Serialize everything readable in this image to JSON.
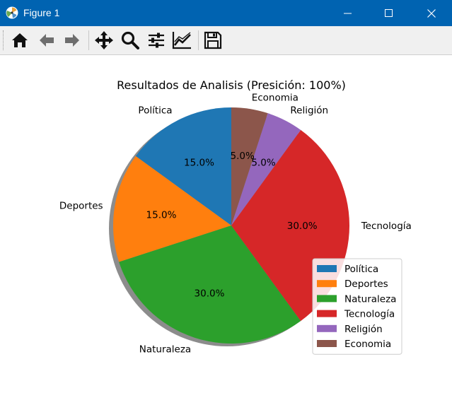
{
  "window": {
    "title": "Figure 1"
  },
  "toolbar": {
    "tools": [
      "home-icon",
      "back-icon",
      "forward-icon",
      "pan-icon",
      "zoom-icon",
      "configure-subplots-icon",
      "edit-axis-icon",
      "save-icon"
    ]
  },
  "chart_data": {
    "type": "pie",
    "title": "Resultados de Analisis (Presición: 100%)",
    "categories": [
      "Política",
      "Deportes",
      "Naturaleza",
      "Tecnología",
      "Religión",
      "Economia"
    ],
    "values": [
      15.0,
      15.0,
      30.0,
      30.0,
      5.0,
      5.0
    ],
    "value_labels": [
      "15.0%",
      "15.0%",
      "30.0%",
      "30.0%",
      "5.0%",
      "5.0%"
    ],
    "colors": [
      "#1f77b4",
      "#ff7f0e",
      "#2ca02c",
      "#d62728",
      "#9467bd",
      "#8c564b"
    ],
    "start_angle": 90,
    "direction": "counterclockwise",
    "shadow": true,
    "legend_position": "lower-right"
  }
}
